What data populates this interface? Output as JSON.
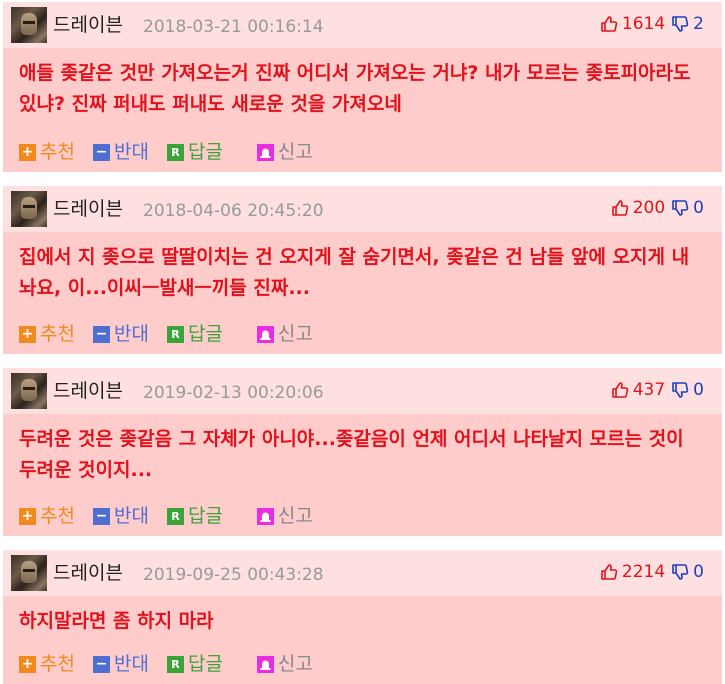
{
  "comments": [
    {
      "nickname": "드레이븐",
      "date": "2018-03-21 00:16:14",
      "up": "1614",
      "down": "2",
      "text": "애들 좆같은 것만 가져오는거 진짜 어디서 가져오는 거냐? 내가 모르는 좆토피아라도 있냐? 진짜 퍼내도 퍼내도 새로운 것을 가져오네"
    },
    {
      "nickname": "드레이븐",
      "date": "2018-04-06 20:45:20",
      "up": "200",
      "down": "0",
      "text": "집에서 지 좆으로 딸딸이치는 건 오지게 잘 숨기면서, 좆같은 건 남들 앞에 오지게 내놔요, 이...이씨ㅡ발새ㅡ끼들 진짜..."
    },
    {
      "nickname": "드레이븐",
      "date": "2019-02-13 00:20:06",
      "up": "437",
      "down": "0",
      "text": "두려운 것은 좆같음 그 자체가 아니야...좆같음이 언제 어디서 나타날지 모르는 것이 두려운 것이지..."
    },
    {
      "nickname": "드레이븐",
      "date": "2019-09-25 00:43:28",
      "up": "2214",
      "down": "0",
      "text": "하지말라면 좀 하지 마라"
    }
  ],
  "actions": {
    "recommend": "추천",
    "oppose": "반대",
    "reply": "답글",
    "report": "신고",
    "recommend_icon": "+",
    "oppose_icon": "−",
    "reply_icon": "R",
    "report_icon": "siren"
  },
  "colors": {
    "header_bg": "#ffe0e0",
    "body_bg": "#ffcccc",
    "text": "#e0121b",
    "upvote": "#e0141b",
    "downvote": "#1e3fbf"
  }
}
